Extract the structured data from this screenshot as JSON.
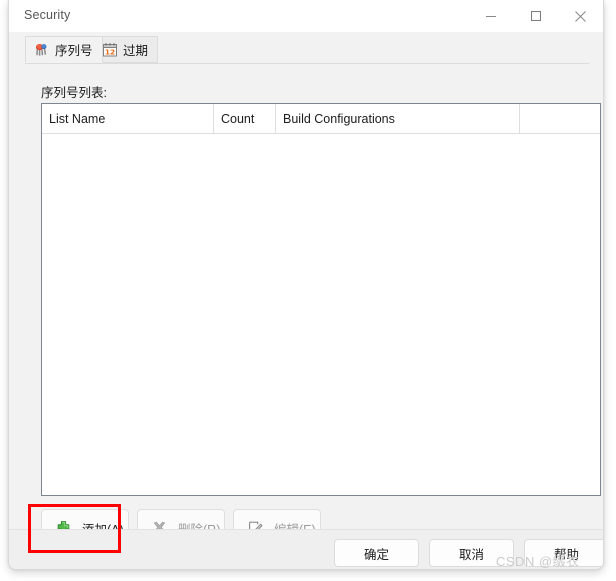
{
  "window": {
    "title": "Security",
    "caption_buttons": [
      {
        "name": "minimize",
        "icon": "minimize-icon"
      },
      {
        "name": "maximize",
        "icon": "maximize-icon"
      },
      {
        "name": "close",
        "icon": "close-icon"
      }
    ]
  },
  "tabs": [
    {
      "label": "序列号",
      "icon": "serial-number-icon",
      "active": true
    },
    {
      "label": "过期",
      "icon": "calendar-icon",
      "active": false
    }
  ],
  "main": {
    "section_label": "序列号列表:",
    "list": {
      "columns": [
        "List Name",
        "Count",
        "Build Configurations",
        ""
      ],
      "rows": []
    }
  },
  "action_buttons": [
    {
      "label_prefix": "添加(",
      "accel": "A",
      "label_suffix": ")",
      "icon": "plus-icon",
      "enabled": true,
      "highlighted": true
    },
    {
      "label_prefix": "删除(",
      "accel": "R",
      "label_suffix": ")",
      "icon": "delete-x-icon",
      "enabled": false,
      "highlighted": false
    },
    {
      "label_prefix": "编辑(",
      "accel": "E",
      "label_suffix": ")",
      "icon": "edit-pencil-icon",
      "enabled": false,
      "highlighted": false
    }
  ],
  "footer_buttons": [
    {
      "label": "确定"
    },
    {
      "label": "取消"
    },
    {
      "label": "帮助"
    }
  ],
  "watermark": "CSDN @缀衣",
  "colors": {
    "highlight_red": "#fe0000",
    "plus_green": "#52b848",
    "calendar_accent": "#ec6c1a",
    "window_bg": "#f2f2f2",
    "listbox_border": "#7a8793"
  }
}
